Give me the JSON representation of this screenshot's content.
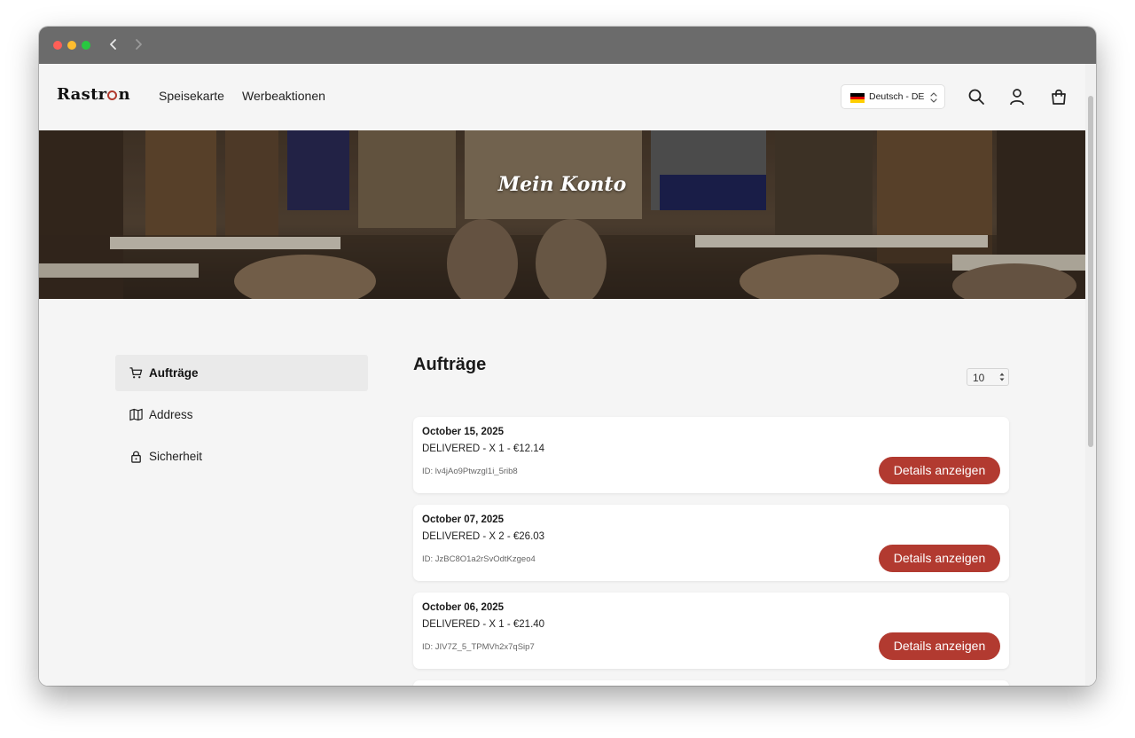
{
  "browser": {
    "controls": [
      "close-dot",
      "minimize-dot",
      "maximize-dot"
    ],
    "back_icon": "chevron-left-icon",
    "forward_icon": "chevron-right-icon"
  },
  "header": {
    "logo_text_a": "Rastr",
    "logo_text_b": "n",
    "nav": {
      "menu": "Speisekarte",
      "promotions": "Werbeaktionen"
    },
    "language": {
      "label": "Deutsch - DE",
      "flag": "germany-flag-icon"
    },
    "icons": [
      "search-icon",
      "account-icon",
      "shopping-bag-icon"
    ]
  },
  "hero": {
    "title": "Mein Konto"
  },
  "sidebar": {
    "items": [
      {
        "label": "Aufträge",
        "icon": "cart-icon",
        "active": true
      },
      {
        "label": "Address",
        "icon": "map-icon",
        "active": false
      },
      {
        "label": "Sicherheit",
        "icon": "lock-icon",
        "active": false
      }
    ]
  },
  "main": {
    "title": "Aufträge",
    "per_page": "10"
  },
  "orders": [
    {
      "date": "October 15, 2025",
      "summary": "DELIVERED - X 1 - €12.14",
      "id": "ID: lv4jAo9Ptwzgl1i_5rib8",
      "button": "Details anzeigen"
    },
    {
      "date": "October 07, 2025",
      "summary": "DELIVERED - X 2 - €26.03",
      "id": "ID: JzBC8O1a2rSvOdtKzgeo4",
      "button": "Details anzeigen"
    },
    {
      "date": "October 06, 2025",
      "summary": "DELIVERED - X 1 - €21.40",
      "id": "ID: JIV7Z_5_TPMVh2x7qSip7",
      "button": "Details anzeigen"
    }
  ],
  "colors": {
    "accent": "#b23a30",
    "background": "#f5f5f5",
    "titlebar": "#6b6b6b"
  }
}
